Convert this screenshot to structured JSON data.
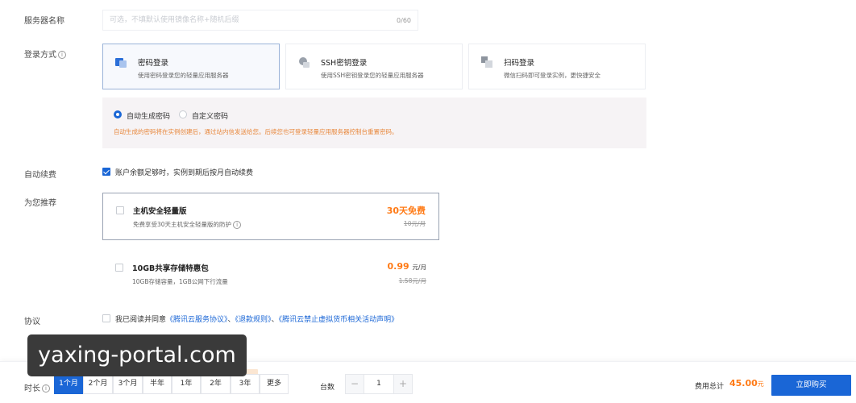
{
  "server_name": {
    "label": "服务器名称",
    "placeholder": "可选，不填默认使用镜像名称+随机后缀",
    "value": "",
    "counter": "0/60"
  },
  "login": {
    "label": "登录方式",
    "info": "i",
    "options": [
      {
        "title": "密码登录",
        "desc": "使用密码登录您的轻量应用服务器",
        "selected": true
      },
      {
        "title": "SSH密钥登录",
        "desc": "使用SSH密钥登录您的轻量应用服务器",
        "selected": false
      },
      {
        "title": "扫码登录",
        "desc": "微信扫码即可登录实例，更快捷安全",
        "selected": false
      }
    ],
    "password": {
      "auto_label": "自动生成密码",
      "custom_label": "自定义密码",
      "selected": "auto",
      "hint": "自动生成的密码将在实例创建后，通过站内信发送给您。后续您也可登录轻量应用服务器控制台重置密码。"
    }
  },
  "auto_renew": {
    "label": "自动续费",
    "checked": true,
    "text": "账户余额足够时，实例到期后按月自动续费"
  },
  "recommend": {
    "label": "为您推荐",
    "items": [
      {
        "title": "主机安全轻量版",
        "desc": "免费享受30天主机安全轻量版的防护",
        "price": "30天免费",
        "unit": "",
        "orig": "10元/月",
        "checked": false
      },
      {
        "title": "10GB共享存储特惠包",
        "desc": "10GB存储容量，1GB公网下行流量",
        "price": "0.99",
        "unit": "元/月",
        "orig": "1.58元/月",
        "checked": false
      }
    ]
  },
  "agreement": {
    "label": "协议",
    "prefix": "我已阅读并同意",
    "link1": "《腾讯云服务协议》",
    "sep1": "、",
    "link2": "《退款规则》",
    "sep2": "、",
    "link3": "《腾讯云禁止虚拟货币相关活动声明》",
    "checked": false
  },
  "watermark": "yaxing-portal.com",
  "bottom_bar": {
    "duration_label": "时长",
    "info": "i",
    "durations": [
      "1个月",
      "2个月",
      "3个月",
      "半年",
      "1年",
      "2年",
      "3年",
      "更多"
    ],
    "selected_duration": "1个月",
    "quantity_label": "台数",
    "minus": "−",
    "quantity": "1",
    "plus": "+",
    "total_label": "费用总计",
    "total_value": "45.00",
    "total_unit": "元",
    "buy_label": "立即购买"
  },
  "colors": {
    "primary": "#1a66d6",
    "accent_orange": "#ff7a15",
    "hint_orange": "#e8873b",
    "panel_bg": "#f6f3f5"
  }
}
